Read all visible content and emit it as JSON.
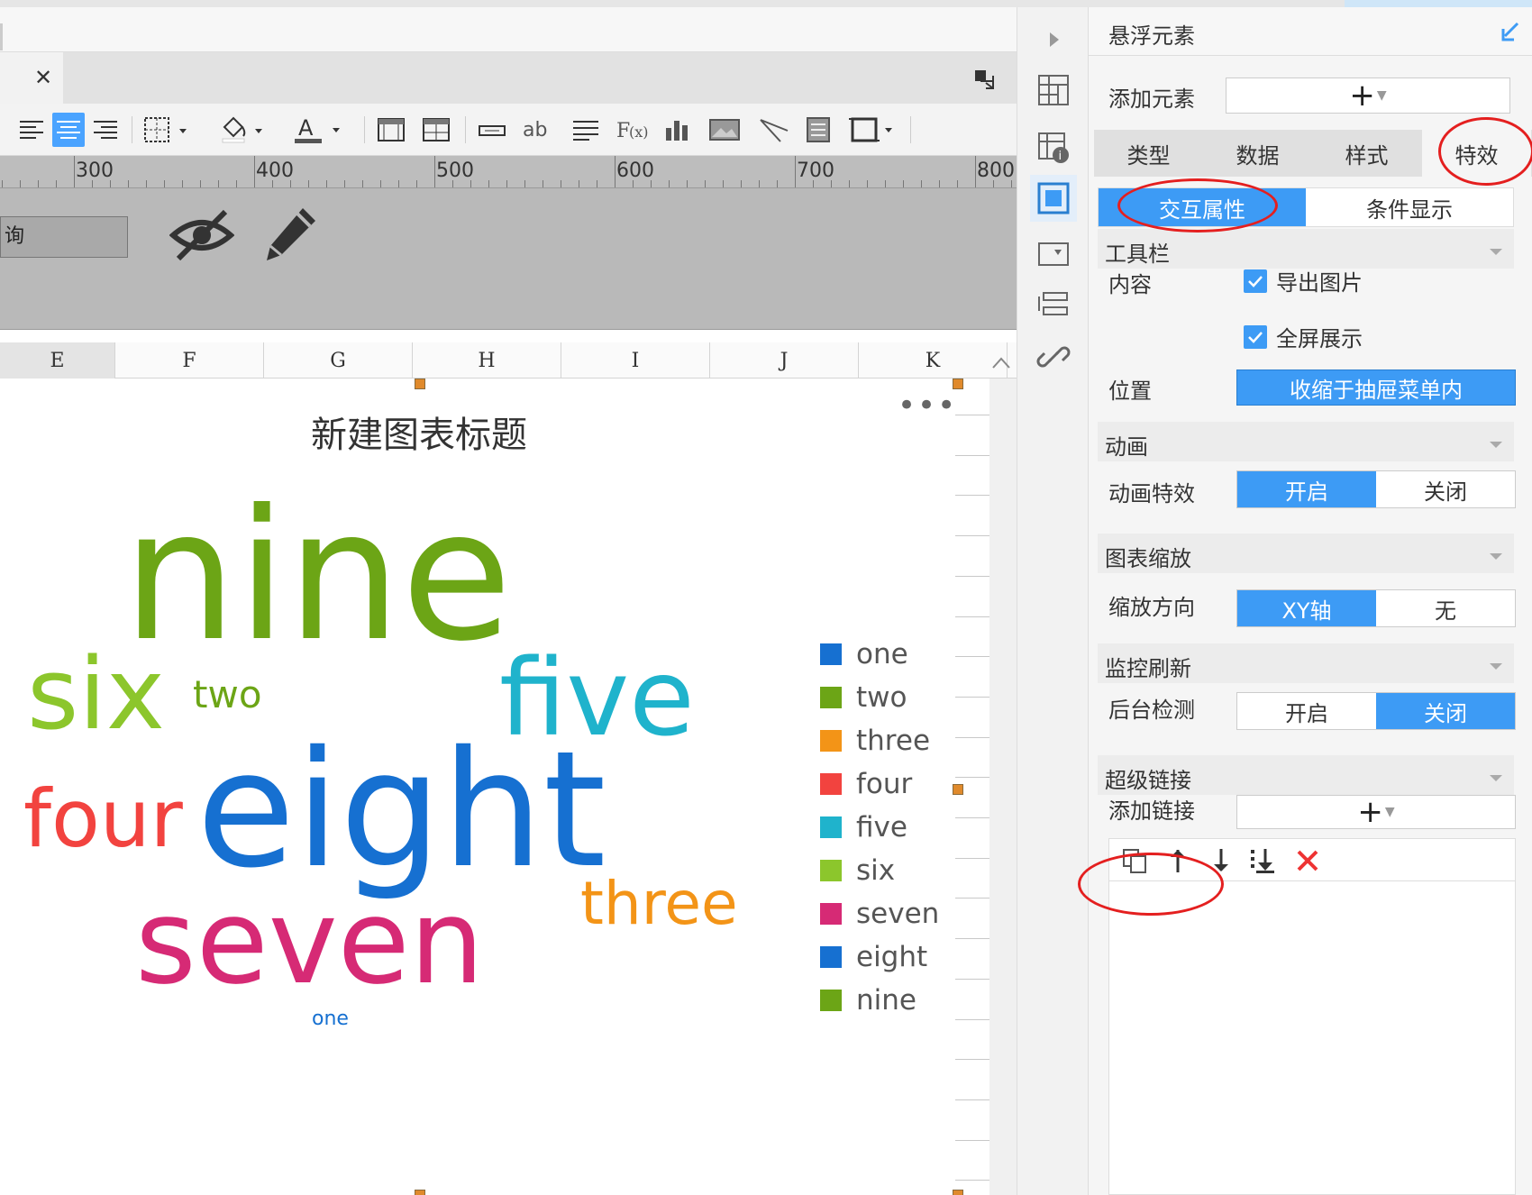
{
  "tab": {
    "close_glyph": "✕"
  },
  "ruler": {
    "labels": [
      "300",
      "400",
      "500",
      "600",
      "700",
      "800"
    ]
  },
  "canvas": {
    "query_button_label": "询"
  },
  "columns": [
    "E",
    "F",
    "G",
    "H",
    "I",
    "J",
    "K"
  ],
  "chart_data": {
    "type": "wordcloud",
    "title": "新建图表标题",
    "more_glyph": "•••",
    "words": [
      {
        "text": "nine",
        "color": "#6ca516"
      },
      {
        "text": "six",
        "color": "#8cc62c"
      },
      {
        "text": "two",
        "color": "#6ca516"
      },
      {
        "text": "five",
        "color": "#1fb3cc"
      },
      {
        "text": "eight",
        "color": "#1670d1"
      },
      {
        "text": "four",
        "color": "#f2433f"
      },
      {
        "text": "three",
        "color": "#f39417"
      },
      {
        "text": "seven",
        "color": "#d62a75"
      },
      {
        "text": "one",
        "color": "#1670d1"
      }
    ],
    "legend": [
      {
        "name": "one",
        "color": "#1670d1"
      },
      {
        "name": "two",
        "color": "#6ca516"
      },
      {
        "name": "three",
        "color": "#f39417"
      },
      {
        "name": "four",
        "color": "#f2433f"
      },
      {
        "name": "five",
        "color": "#1fb3cc"
      },
      {
        "name": "six",
        "color": "#8cc62c"
      },
      {
        "name": "seven",
        "color": "#d62a75"
      },
      {
        "name": "eight",
        "color": "#1670d1"
      },
      {
        "name": "nine",
        "color": "#6ca516"
      }
    ]
  },
  "panel": {
    "title": "悬浮元素",
    "add_element_label": "添加元素",
    "add_glyph": "+",
    "main_tabs": [
      "类型",
      "数据",
      "样式",
      "特效"
    ],
    "active_main_tab": "特效",
    "sub_tabs": [
      "交互属性",
      "条件显示"
    ],
    "active_sub_tab": "交互属性",
    "toolbar_section": "工具栏",
    "content_label": "内容",
    "export_image": "导出图片",
    "fullscreen": "全屏展示",
    "position_label": "位置",
    "position_value": "收缩于抽屉菜单内",
    "animation_section": "动画",
    "animation_effect_label": "动画特效",
    "on": "开启",
    "off": "关闭",
    "zoom_section": "图表缩放",
    "zoom_direction_label": "缩放方向",
    "zoom_xy": "XY轴",
    "zoom_none": "无",
    "monitor_section": "监控刷新",
    "background_check_label": "后台检测",
    "hyperlink_section": "超级链接",
    "add_link_label": "添加链接"
  },
  "colors": {
    "accent": "#3d9bf5",
    "annotation": "#e41f1f"
  }
}
